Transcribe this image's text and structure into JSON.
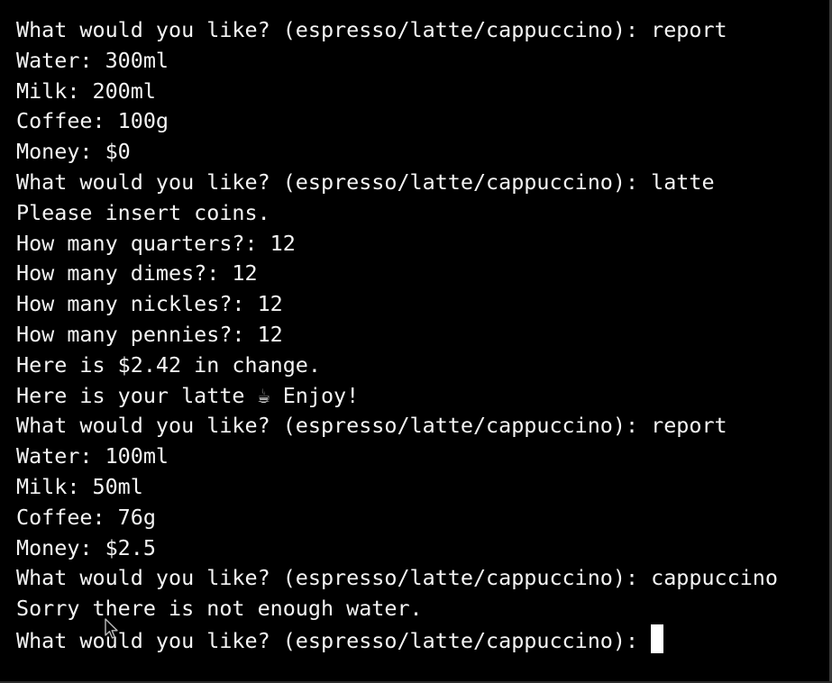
{
  "terminal": {
    "lines": [
      "What would you like? (espresso/latte/cappuccino): report",
      "Water: 300ml",
      "Milk: 200ml",
      "Coffee: 100g",
      "Money: $0",
      "What would you like? (espresso/latte/cappuccino): latte",
      "Please insert coins.",
      "How many quarters?: 12",
      "How many dimes?: 12",
      "How many nickles?: 12",
      "How many pennies?: 12",
      "Here is $2.42 in change.",
      "Here is your latte ☕ Enjoy!",
      "What would you like? (espresso/latte/cappuccino): report",
      "Water: 100ml",
      "Milk: 50ml",
      "Coffee: 76g",
      "Money: $2.5",
      "What would you like? (espresso/latte/cappuccino): cappuccino",
      "Sorry there is not enough water.",
      "What would you like? (espresso/latte/cappuccino): "
    ]
  },
  "colors": {
    "background": "#000000",
    "foreground": "#f4f4f4",
    "cursor": "#ffffff"
  },
  "icons": {
    "pointer": "mouse-pointer-icon",
    "cursor": "block-cursor"
  }
}
